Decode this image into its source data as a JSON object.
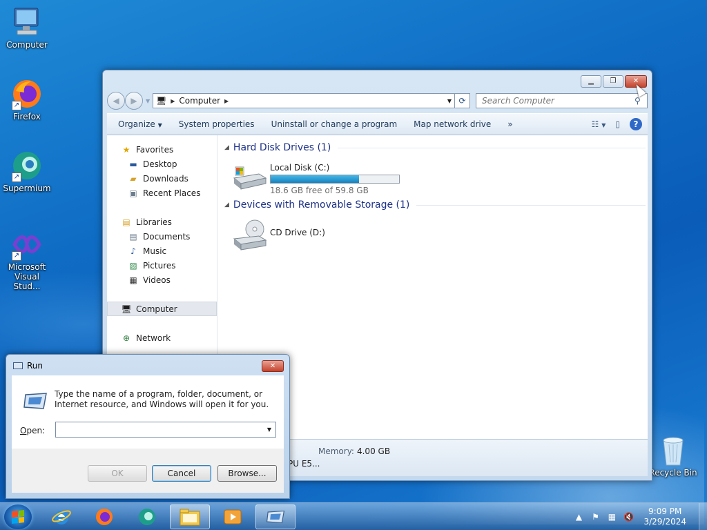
{
  "desktop": {
    "icons": [
      {
        "label": "Computer"
      },
      {
        "label": "Firefox"
      },
      {
        "label": "Supermium"
      },
      {
        "label": "Microsoft Visual Stud..."
      },
      {
        "label": "Recycle Bin"
      }
    ]
  },
  "explorer": {
    "address": {
      "crumb": "Computer"
    },
    "search": {
      "placeholder": "Search Computer"
    },
    "toolbar": {
      "organize": "Organize",
      "system_properties": "System properties",
      "uninstall": "Uninstall or change a program",
      "map_drive": "Map network drive",
      "more": "»"
    },
    "nav": {
      "favorites": "Favorites",
      "desktop": "Desktop",
      "downloads": "Downloads",
      "recent": "Recent Places",
      "libraries": "Libraries",
      "documents": "Documents",
      "music": "Music",
      "pictures": "Pictures",
      "videos": "Videos",
      "computer": "Computer",
      "network": "Network"
    },
    "groups": {
      "hdd": "Hard Disk Drives (1)",
      "removable": "Devices with Removable Storage (1)"
    },
    "drives": {
      "c_name": "Local Disk (C:)",
      "c_free": "18.6 GB free of 59.8 GB",
      "c_used_fraction": 0.69,
      "d_name": "CD Drive (D:)"
    },
    "details": {
      "memory_label": "Memory:",
      "memory_value": "4.00 GB",
      "cpu_partial": "PU E5..."
    }
  },
  "run": {
    "title": "Run",
    "message": "Type the name of a program, folder, document, or Internet resource, and Windows will open it for you.",
    "open_label": "Open:",
    "open_value": "",
    "ok": "OK",
    "cancel": "Cancel",
    "browse": "Browse..."
  },
  "taskbar": {
    "time": "9:09 PM",
    "date": "3/29/2024"
  }
}
